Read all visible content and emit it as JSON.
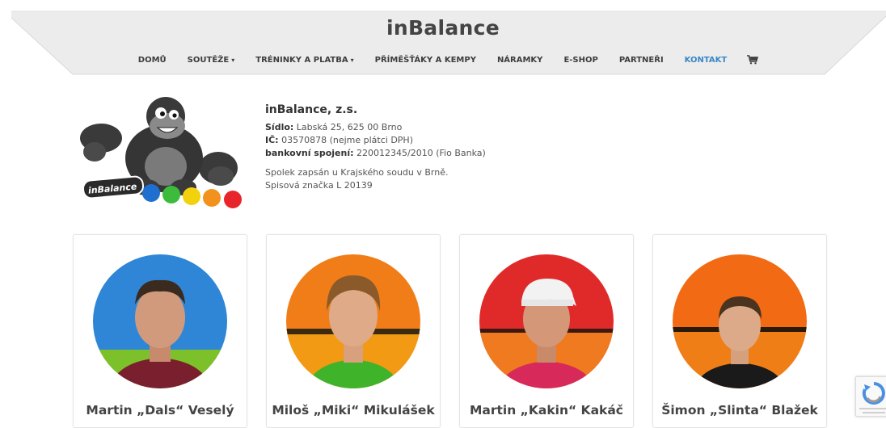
{
  "site": {
    "title": "inBalance"
  },
  "nav": {
    "items": [
      {
        "label": "DOMŮ"
      },
      {
        "label": "SOUTĚŽE"
      },
      {
        "label": "TRÉNINKY A PLATBA"
      },
      {
        "label": "PŘÍMĚŠŤÁKY A KEMPY"
      },
      {
        "label": "NÁRAMKY"
      },
      {
        "label": "E-SHOP"
      },
      {
        "label": "PARTNEŘI"
      },
      {
        "label": "KONTAKT"
      }
    ],
    "caret": "▾"
  },
  "logo": {
    "text": "inBalance"
  },
  "organization": {
    "name": "inBalance, z.s.",
    "seat_label": "Sídlo:",
    "seat_value": "Labská 25, 625 00 Brno",
    "ic_label": "IČ:",
    "ic_value": "03570878 (nejme plátci DPH)",
    "bank_label": "bankovní spojení:",
    "bank_value": "220012345/2010 (Fio Banka)",
    "register_line1": "Spolek zapsán u Krajského soudu v Brně.",
    "register_line2": "Spisová značka L 20139"
  },
  "team": [
    {
      "name": "Martin „Dals“ Veselý"
    },
    {
      "name": "Miloš „Miki“ Mikulášek"
    },
    {
      "name": "Martin „Kakin“ Kakáč"
    },
    {
      "name": "Šimon „Slinta“ Blažek"
    }
  ],
  "colors": {
    "accent": "#3a87c6",
    "header_bg": "#ededed"
  }
}
